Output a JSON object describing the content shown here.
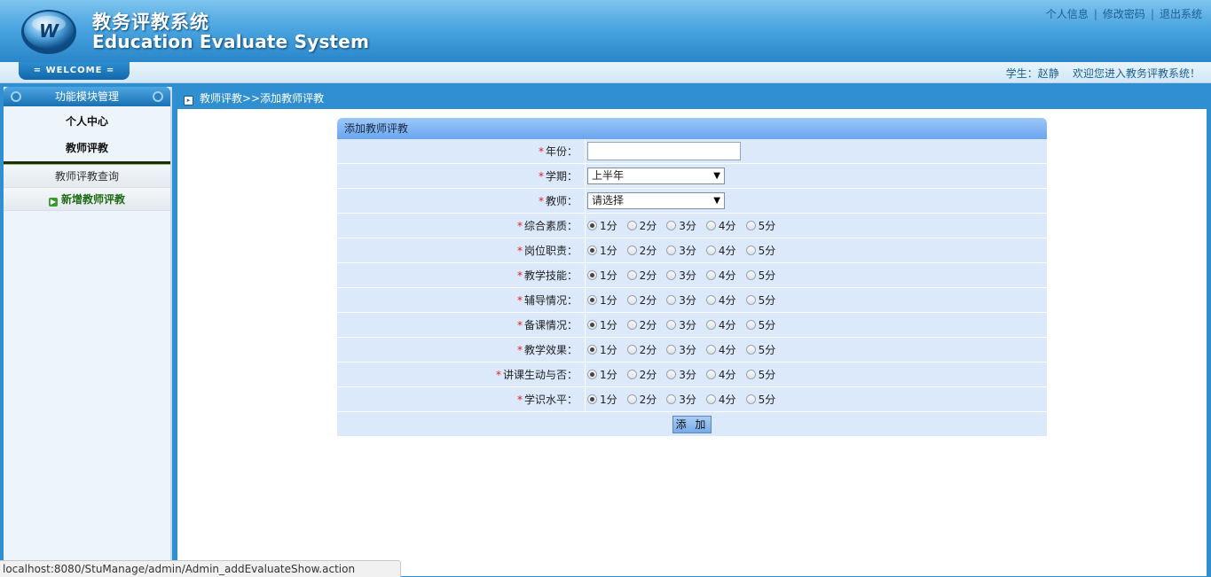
{
  "header": {
    "title_cn": "教务评教系统",
    "title_en": "Education Evaluate System",
    "links": [
      "个人信息",
      "修改密码",
      "退出系统"
    ]
  },
  "strip": {
    "welcome": "= WELCOME =",
    "user_label": "学生：赵静",
    "greeting": "欢迎您进入教务评教系统！"
  },
  "sidebar": {
    "header": "功能模块管理",
    "categories": [
      "个人中心",
      "教师评教"
    ],
    "sub_items": [
      "教师评教查询",
      "新增教师评教"
    ],
    "active_sub": "新增教师评教"
  },
  "breadcrumb": "教师评教>>添加教师评教",
  "form": {
    "title": "添加教师评教",
    "year_label": "年份：",
    "year_value": "",
    "semester_label": "学期：",
    "semester_value": "上半年",
    "teacher_label": "教师：",
    "teacher_value": "请选择",
    "options": [
      "1分",
      "2分",
      "3分",
      "4分",
      "5分"
    ],
    "criteria": [
      {
        "label": "综合素质：",
        "selected": "1分"
      },
      {
        "label": "岗位职责：",
        "selected": "1分"
      },
      {
        "label": "教学技能：",
        "selected": "1分"
      },
      {
        "label": "辅导情况：",
        "selected": "1分"
      },
      {
        "label": "备课情况：",
        "selected": "1分"
      },
      {
        "label": "教学效果：",
        "selected": "1分"
      },
      {
        "label": "讲课生动与否：",
        "selected": "1分"
      },
      {
        "label": "学识水平：",
        "selected": "1分"
      }
    ],
    "required_mark": "*",
    "submit_label": "添 加"
  },
  "status_bar": "localhost:8080/StuManage/admin/Admin_addEvaluateShow.action",
  "colors": {
    "header_blue": "#2a86c9",
    "form_row": "#dbe9fb",
    "required": "#e02020",
    "active_green": "#1f6a16"
  }
}
